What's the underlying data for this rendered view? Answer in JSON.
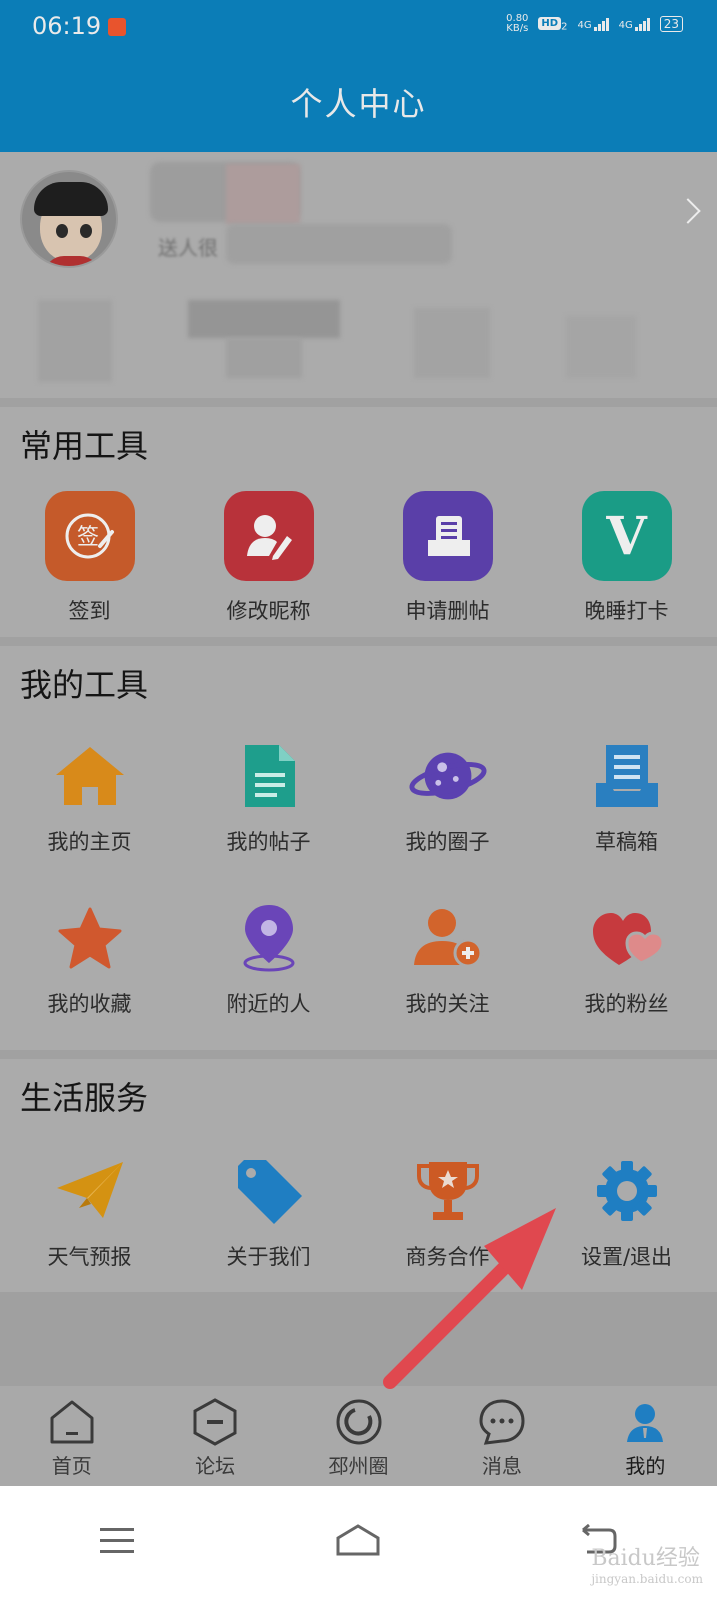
{
  "status_bar": {
    "time": "06:19",
    "net_speed_value": "0.80",
    "net_speed_unit": "KB/s",
    "hd_label": "HD",
    "hd_sub": "2",
    "net_type_1": "4G",
    "net_type_2": "4G",
    "battery": "23"
  },
  "header": {
    "title": "个人中心"
  },
  "profile": {
    "subtitle_visible": "送人很"
  },
  "sections": {
    "common_tools": {
      "title": "常用工具",
      "items": [
        {
          "label": "签到",
          "icon": "sign-in-icon",
          "glyph": "签",
          "color": "#c55a2a"
        },
        {
          "label": "修改昵称",
          "icon": "edit-nickname-icon",
          "color": "#b8323a"
        },
        {
          "label": "申请删帖",
          "icon": "delete-post-icon",
          "color": "#5a3fa8"
        },
        {
          "label": "晚睡打卡",
          "icon": "late-sleep-checkin-icon",
          "glyph": "V",
          "color": "#1a9c86"
        }
      ]
    },
    "my_tools": {
      "title": "我的工具",
      "items": [
        {
          "label": "我的主页",
          "icon": "home-icon",
          "color": "#d88a1a"
        },
        {
          "label": "我的帖子",
          "icon": "document-icon",
          "color": "#1e9e8c"
        },
        {
          "label": "我的圈子",
          "icon": "planet-icon",
          "color": "#5b41b0"
        },
        {
          "label": "草稿箱",
          "icon": "drafts-icon",
          "color": "#2a7fc0"
        },
        {
          "label": "我的收藏",
          "icon": "star-icon",
          "color": "#d0582e"
        },
        {
          "label": "附近的人",
          "icon": "location-pin-icon",
          "color": "#6a45b8"
        },
        {
          "label": "我的关注",
          "icon": "follow-user-icon",
          "color": "#d2642c"
        },
        {
          "label": "我的粉丝",
          "icon": "hearts-icon",
          "color": "#c63a3e"
        }
      ]
    },
    "life_services": {
      "title": "生活服务",
      "items": [
        {
          "label": "天气预报",
          "icon": "paper-plane-icon",
          "color": "#d49212"
        },
        {
          "label": "关于我们",
          "icon": "tag-icon",
          "color": "#1f7ec2"
        },
        {
          "label": "商务合作",
          "icon": "trophy-icon",
          "color": "#cc5a24"
        },
        {
          "label": "设置/退出",
          "icon": "gear-icon",
          "color": "#1f7ec2"
        }
      ]
    }
  },
  "tabbar": {
    "items": [
      {
        "label": "首页",
        "icon": "home-tab-icon"
      },
      {
        "label": "论坛",
        "icon": "forum-tab-icon"
      },
      {
        "label": "邳州圈",
        "icon": "circle-tab-icon"
      },
      {
        "label": "消息",
        "icon": "message-tab-icon"
      },
      {
        "label": "我的",
        "icon": "profile-tab-icon"
      }
    ],
    "active_color": "#1f7ec2"
  },
  "watermark": "Baidu经验",
  "watermark_url": "jingyan.baidu.com"
}
